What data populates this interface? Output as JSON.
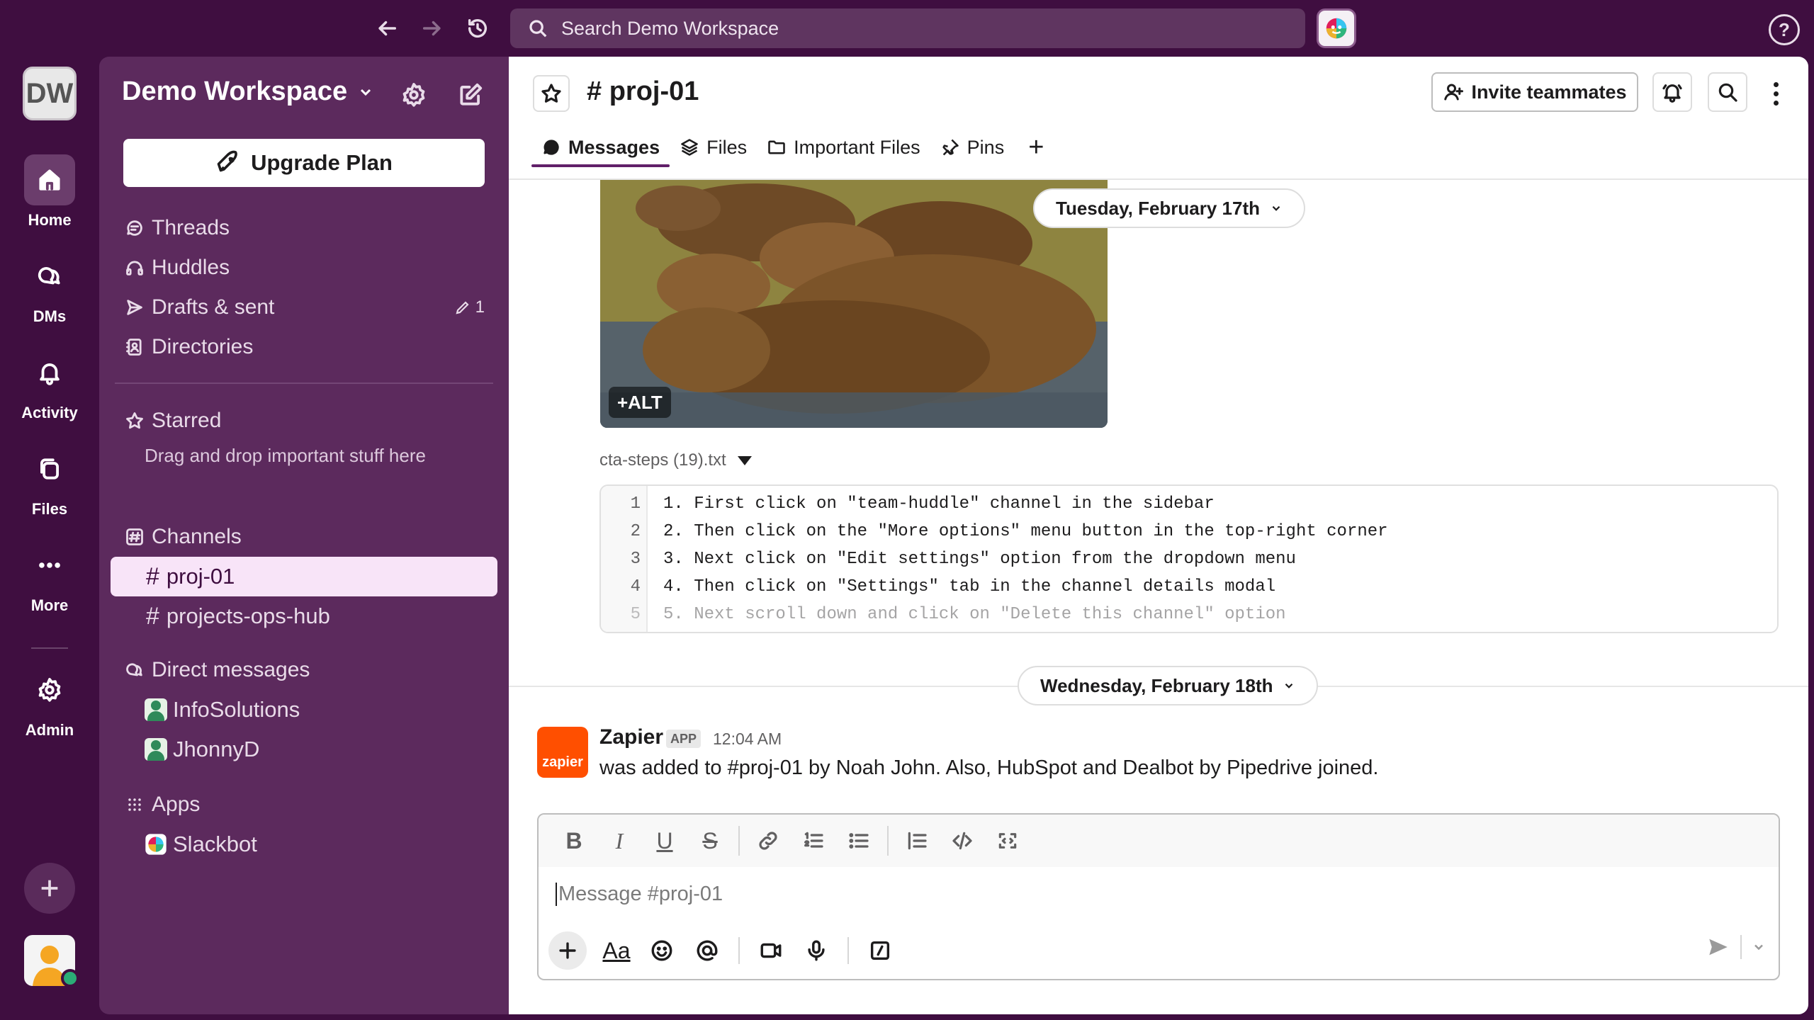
{
  "search": {
    "placeholder": "Search Demo Workspace"
  },
  "rail": {
    "workspace_initials": "DW",
    "items": [
      {
        "label": "Home"
      },
      {
        "label": "DMs"
      },
      {
        "label": "Activity"
      },
      {
        "label": "Files"
      },
      {
        "label": "More"
      },
      {
        "label": "Admin"
      }
    ]
  },
  "sidebar": {
    "workspace_name": "Demo Workspace",
    "upgrade_label": "Upgrade Plan",
    "nav": [
      {
        "label": "Threads",
        "icon": "threads-icon"
      },
      {
        "label": "Huddles",
        "icon": "headphones-icon"
      },
      {
        "label": "Drafts & sent",
        "icon": "send-icon",
        "count": "1"
      },
      {
        "label": "Directories",
        "icon": "directory-icon"
      }
    ],
    "starred": {
      "label": "Starred",
      "hint": "Drag and drop important stuff here"
    },
    "channels": {
      "label": "Channels",
      "items": [
        {
          "name": "proj-01",
          "active": true
        },
        {
          "name": "projects-ops-hub"
        }
      ]
    },
    "direct_messages": {
      "label": "Direct messages",
      "items": [
        {
          "name": "InfoSolutions"
        },
        {
          "name": "JhonnyD"
        }
      ]
    },
    "apps": {
      "label": "Apps",
      "items": [
        {
          "name": "Slackbot"
        }
      ]
    }
  },
  "channel": {
    "name": "# proj-01",
    "invite_label": "Invite teammates",
    "tabs": [
      {
        "label": "Messages",
        "active": true
      },
      {
        "label": "Files"
      },
      {
        "label": "Important Files"
      },
      {
        "label": "Pins"
      }
    ]
  },
  "messages": {
    "image_alt_label": "+ALT",
    "date1": "Tuesday, February 17th",
    "file": {
      "name": "cta-steps (19).txt",
      "lines": [
        {
          "n": "1",
          "text": "1. First click on \"team-huddle\" channel in the sidebar"
        },
        {
          "n": "2",
          "text": "2. Then click on the \"More options\" menu button in the top-right corner"
        },
        {
          "n": "3",
          "text": "3. Next click on \"Edit settings\" option from the dropdown menu"
        },
        {
          "n": "4",
          "text": "4. Then click on \"Settings\" tab in the channel details modal"
        },
        {
          "n": "5",
          "text": "5. Next scroll down and click on \"Delete this channel\" option"
        }
      ]
    },
    "date2": "Wednesday, February 18th",
    "post": {
      "sender": "Zapier",
      "badge": "APP",
      "time": "12:04 AM",
      "avatar_text": "zapier",
      "text": "was added to #proj-01 by Noah John. Also, HubSpot and Dealbot by Pipedrive joined."
    }
  },
  "composer": {
    "placeholder": "Message #proj-01",
    "format_b": "B",
    "format_i": "I",
    "format_u": "U",
    "format_s": "S",
    "aa_label": "Aa"
  },
  "colors": {
    "aubergine": "#3f0e40",
    "sidebar": "#5c2a5d",
    "accent": "#611f69",
    "zapier": "#ff4f00"
  }
}
